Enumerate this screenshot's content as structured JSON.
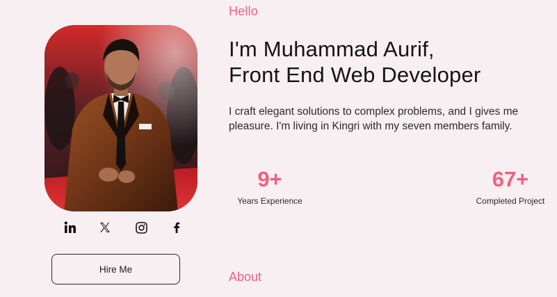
{
  "profile": {
    "photo_alt": "Portrait of Muhammad Aurif",
    "greeting": "Hello",
    "headline_line1": "I'm Muhammad Aurif,",
    "headline_line2": "Front End Web Developer",
    "bio": "I craft elegant solutions to complex problems, and I gives me pleasure. I'm living in Kingri with my seven members family."
  },
  "socials": [
    {
      "icon": "linkedin-icon"
    },
    {
      "icon": "x-icon"
    },
    {
      "icon": "instagram-icon"
    },
    {
      "icon": "facebook-icon"
    }
  ],
  "actions": {
    "hire_label": "Hire Me"
  },
  "stats": [
    {
      "value": "9+",
      "label": "Years Experience"
    },
    {
      "value": "67+",
      "label": "Completed Project"
    }
  ],
  "sections": {
    "about_title": "About"
  },
  "colors": {
    "accent": "#f0607e",
    "background": "#f7eff2",
    "text": "#141414"
  }
}
